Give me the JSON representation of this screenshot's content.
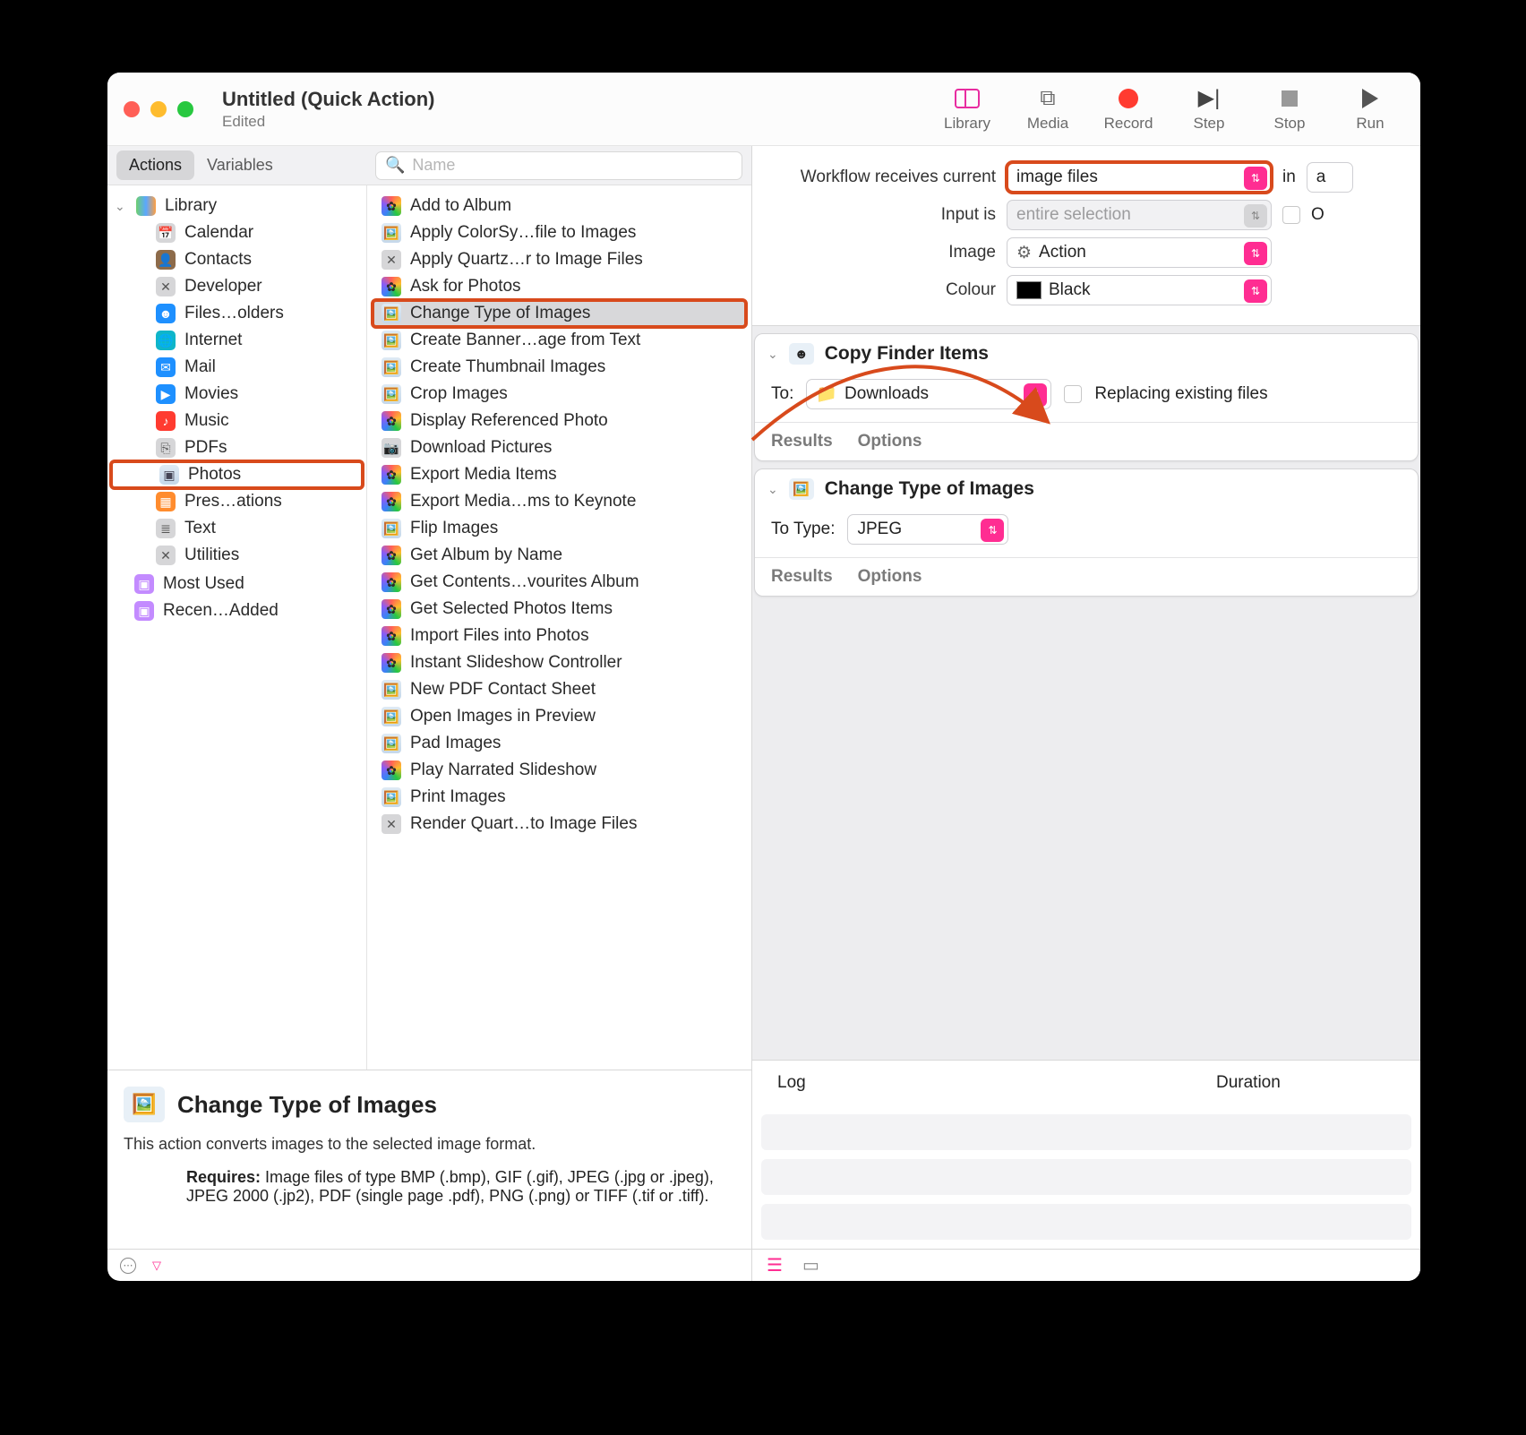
{
  "window": {
    "title": "Untitled (Quick Action)",
    "subtitle": "Edited"
  },
  "toolbar": {
    "library": "Library",
    "media": "Media",
    "record": "Record",
    "step": "Step",
    "stop": "Stop",
    "run": "Run"
  },
  "subbar": {
    "actions": "Actions",
    "variables": "Variables",
    "search_placeholder": "Name"
  },
  "sidebar": {
    "root": "Library",
    "items": [
      {
        "label": "Calendar",
        "icon": "📅",
        "cls": "c-gray"
      },
      {
        "label": "Contacts",
        "icon": "👤",
        "cls": "c-brown"
      },
      {
        "label": "Developer",
        "icon": "✕",
        "cls": "c-gray"
      },
      {
        "label": "Files…olders",
        "icon": "☻",
        "cls": "c-blue"
      },
      {
        "label": "Internet",
        "icon": "🌐",
        "cls": "c-teal"
      },
      {
        "label": "Mail",
        "icon": "✉︎",
        "cls": "c-blue"
      },
      {
        "label": "Movies",
        "icon": "▶︎",
        "cls": "c-blue"
      },
      {
        "label": "Music",
        "icon": "♪",
        "cls": "c-red"
      },
      {
        "label": "PDFs",
        "icon": "⎘",
        "cls": "c-gray"
      },
      {
        "label": "Photos",
        "icon": "▣",
        "cls": "img-ico",
        "highlight": true
      },
      {
        "label": "Pres…ations",
        "icon": "▦",
        "cls": "c-orange"
      },
      {
        "label": "Text",
        "icon": "≣",
        "cls": "c-gray"
      },
      {
        "label": "Utilities",
        "icon": "✕",
        "cls": "c-gray"
      }
    ],
    "extras": [
      {
        "label": "Most Used",
        "icon": "▣",
        "cls": "c-folder"
      },
      {
        "label": "Recen…Added",
        "icon": "▣",
        "cls": "c-folder"
      }
    ]
  },
  "actions": [
    {
      "label": "Add to Album",
      "icon": "photos"
    },
    {
      "label": "Apply ColorSy…file to Images",
      "icon": "img"
    },
    {
      "label": "Apply Quartz…r to Image Files",
      "icon": "util"
    },
    {
      "label": "Ask for Photos",
      "icon": "photos"
    },
    {
      "label": "Change Type of Images",
      "icon": "img",
      "selected": true,
      "highlight": true
    },
    {
      "label": "Create Banner…age from Text",
      "icon": "img"
    },
    {
      "label": "Create Thumbnail Images",
      "icon": "img"
    },
    {
      "label": "Crop Images",
      "icon": "img"
    },
    {
      "label": "Display Referenced Photo",
      "icon": "photos"
    },
    {
      "label": "Download Pictures",
      "icon": "cam"
    },
    {
      "label": "Export Media Items",
      "icon": "photos"
    },
    {
      "label": "Export Media…ms to Keynote",
      "icon": "photos"
    },
    {
      "label": "Flip Images",
      "icon": "img"
    },
    {
      "label": "Get Album by Name",
      "icon": "photos"
    },
    {
      "label": "Get Contents…vourites Album",
      "icon": "photos"
    },
    {
      "label": "Get Selected Photos Items",
      "icon": "photos"
    },
    {
      "label": "Import Files into Photos",
      "icon": "photos"
    },
    {
      "label": "Instant Slideshow Controller",
      "icon": "photos"
    },
    {
      "label": "New PDF Contact Sheet",
      "icon": "img"
    },
    {
      "label": "Open Images in Preview",
      "icon": "img"
    },
    {
      "label": "Pad Images",
      "icon": "img"
    },
    {
      "label": "Play Narrated Slideshow",
      "icon": "photos"
    },
    {
      "label": "Print Images",
      "icon": "img"
    },
    {
      "label": "Render Quart…to Image Files",
      "icon": "util"
    }
  ],
  "description": {
    "title": "Change Type of Images",
    "body": "This action converts images to the selected image format.",
    "requires_label": "Requires:",
    "requires_text": "Image files of type BMP (.bmp), GIF (.gif), JPEG (.jpg or .jpeg), JPEG 2000 (.jp2), PDF (single page .pdf), PNG (.png) or TIFF (.tif or .tiff)."
  },
  "config": {
    "receives_label": "Workflow receives current",
    "receives_value": "image files",
    "in_label": "in",
    "input_is_label": "Input is",
    "input_is_value": "entire selection",
    "image_label": "Image",
    "image_value": "Action",
    "colour_label": "Colour",
    "colour_value": "Black"
  },
  "nodes": {
    "copy": {
      "title": "Copy Finder Items",
      "to_label": "To:",
      "to_value": "Downloads",
      "replacing_label": "Replacing existing files",
      "results": "Results",
      "options": "Options"
    },
    "change": {
      "title": "Change Type of Images",
      "totype_label": "To Type:",
      "totype_value": "JPEG",
      "results": "Results",
      "options": "Options"
    }
  },
  "log": {
    "col1": "Log",
    "col2": "Duration"
  },
  "checkbox_other_label": "O"
}
